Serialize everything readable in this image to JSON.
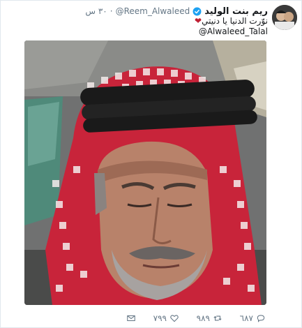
{
  "tweet": {
    "author_name": "ريم بنت الوليد",
    "handle": "@Reem_Alwaleed",
    "separator": "·",
    "time": "٣٠ س",
    "text": "نوّرت الدنيا يا دنيتي",
    "heart": "❤",
    "mention": "@Alwaleed_Talal"
  },
  "actions": {
    "reply_count": "٦٨٧",
    "retweet_count": "٩٨٩",
    "like_count": "٧٩٩"
  },
  "colors": {
    "verified": "#1da1f2",
    "heart": "#c01f34",
    "meta_text": "#657786"
  }
}
